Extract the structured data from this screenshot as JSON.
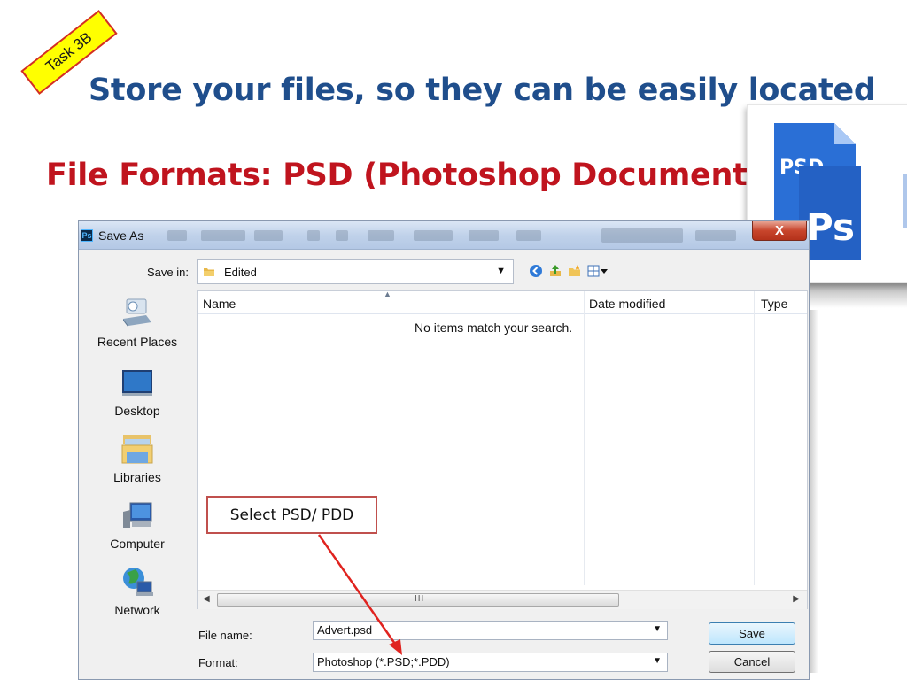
{
  "slide": {
    "task_badge": "Task 3B",
    "title": "Store your files, so they can be easily located",
    "subtitle": "File Formats: PSD (Photoshop Document)",
    "psd_icon": {
      "top_text": "PSD",
      "bottom_text": "Ps",
      "icon": "psd-file-icon"
    }
  },
  "dialog": {
    "app_badge": "Ps",
    "title": "Save As",
    "close_label": "X",
    "save_in_label": "Save in:",
    "location": "Edited",
    "places": [
      {
        "label": "Recent Places",
        "icon": "recent-places-icon"
      },
      {
        "label": "Desktop",
        "icon": "desktop-icon"
      },
      {
        "label": "Libraries",
        "icon": "libraries-icon"
      },
      {
        "label": "Computer",
        "icon": "computer-icon"
      },
      {
        "label": "Network",
        "icon": "network-icon"
      }
    ],
    "columns": {
      "name": "Name",
      "date_modified": "Date modified",
      "type": "Type"
    },
    "empty_message": "No items match your search.",
    "scroll_grip": "III",
    "file_name_label": "File name:",
    "file_name_value": "Advert.psd",
    "format_label": "Format:",
    "format_value": "Photoshop (*.PSD;*.PDD)",
    "save_button": "Save",
    "cancel_button": "Cancel"
  },
  "callout": {
    "text": "Select PSD/ PDD"
  },
  "colors": {
    "title_blue": "#1f4e8c",
    "subtitle_red": "#c0141e",
    "callout_border": "#c0504d",
    "arrow_red": "#e0231f",
    "badge_yellow": "#ffff00"
  }
}
